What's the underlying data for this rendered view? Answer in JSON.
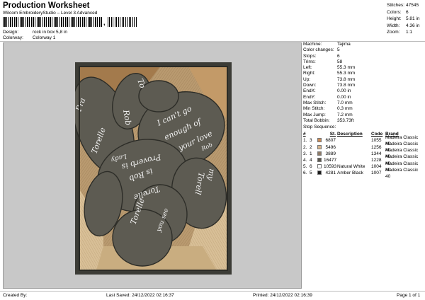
{
  "header": {
    "title": "Production Worksheet",
    "subtitle": "Wilcom EmbroideryStudio – Level 3 Advanced",
    "barcode_sep": ","
  },
  "meta": {
    "design_label": "Design:",
    "design_value": "rock in box 5,8 in",
    "colorway_label": "Colorway:",
    "colorway_value": "Colorway 1"
  },
  "stats": [
    {
      "k": "Stitches:",
      "v": "47545"
    },
    {
      "k": "Colors:",
      "v": "6"
    },
    {
      "k": "Height:",
      "v": "5.81 in"
    },
    {
      "k": "Width:",
      "v": "4.36 in"
    },
    {
      "k": "Zoom:",
      "v": "1:1"
    }
  ],
  "info": [
    {
      "k": "Machine:",
      "v": "Tajima"
    },
    {
      "k": "Color changes:",
      "v": "5"
    },
    {
      "k": "Stops:",
      "v": "6"
    },
    {
      "k": "Trims:",
      "v": "58"
    },
    {
      "k": "Left:",
      "v": "55.3 mm"
    },
    {
      "k": "Right:",
      "v": "55.3 mm"
    },
    {
      "k": "Up:",
      "v": "73.8 mm"
    },
    {
      "k": "Down:",
      "v": "73.8 mm"
    },
    {
      "k": "EndX:",
      "v": "0.00 in"
    },
    {
      "k": "EndY:",
      "v": "0.00 in"
    },
    {
      "k": "Max Stitch:",
      "v": "7.0 mm"
    },
    {
      "k": "Min Stitch:",
      "v": "0.3 mm"
    },
    {
      "k": "Max Jump:",
      "v": "7.2 mm"
    },
    {
      "k": "Total Bobbin:",
      "v": "353.73ft"
    }
  ],
  "stop_sequence": {
    "label": "Stop Sequence:",
    "headers": {
      "n": "#",
      "st": "St.",
      "desc": "Description",
      "code": "Code",
      "brand": "Brand"
    },
    "rows": [
      {
        "a": "1.",
        "b": "3",
        "color": "#c98a55",
        "st": "6807",
        "desc": "",
        "code": "1055",
        "brand": "Madeira Classic 40"
      },
      {
        "a": "2.",
        "b": "2",
        "color": "#d6b48a",
        "st": "5496",
        "desc": "",
        "code": "1256",
        "brand": "Madeira Classic 40"
      },
      {
        "a": "3.",
        "b": "1",
        "color": "#8e7a66",
        "st": "3889",
        "desc": "",
        "code": "1344",
        "brand": "Madeira Classic 40"
      },
      {
        "a": "4.",
        "b": "4",
        "color": "#5b574d",
        "st": "16477",
        "desc": "",
        "code": "1228",
        "brand": "Madeira Classic 40"
      },
      {
        "a": "5.",
        "b": "6",
        "color": "#ffffff",
        "st": "10593",
        "desc": "Natural White",
        "code": "1004",
        "brand": "Madeira Classic 40"
      },
      {
        "a": "6.",
        "b": "5",
        "color": "#1c1c1c",
        "st": "4281",
        "desc": "Amber Black",
        "code": "1007",
        "brand": "Madeira Classic 40"
      }
    ]
  },
  "design_text": {
    "t1": "Rob",
    "t2": "Torelle",
    "t3": "I can't go",
    "t4": "enough of",
    "t5": "your love",
    "t6": "Rob",
    "t7": "Proverb is",
    "t8": "Lady",
    "t9": "is Rob",
    "t10": "Torelle",
    "t11": "Torelle",
    "t12": "you see",
    "t13": "my",
    "t14": "Torell",
    "t15": "Pra",
    "t16": "To"
  },
  "footer": {
    "created": "Created By:",
    "saved": "Last Saved: 24/12/2022 02:16:37",
    "printed": "Printed: 24/12/2022 02:16:39",
    "page": "Page 1 of 1"
  }
}
